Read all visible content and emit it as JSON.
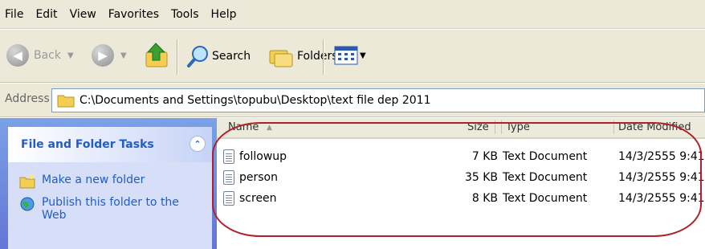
{
  "menu": [
    "File",
    "Edit",
    "View",
    "Favorites",
    "Tools",
    "Help"
  ],
  "toolbar": {
    "back_label": "Back",
    "search_label": "Search",
    "folders_label": "Folders"
  },
  "address": {
    "label": "Address",
    "path": "C:\\Documents and Settings\\topubu\\Desktop\\text file dep 2011"
  },
  "tasks": {
    "title": "File and Folder Tasks",
    "items": [
      "Make a new folder",
      "Publish this folder to the Web"
    ]
  },
  "columns": {
    "name": "Name",
    "size": "Size",
    "type": "Type",
    "date": "Date Modified"
  },
  "files": [
    {
      "name": "followup",
      "size": "7 KB",
      "type": "Text Document",
      "date": "14/3/2555 9:41"
    },
    {
      "name": "person",
      "size": "35 KB",
      "type": "Text Document",
      "date": "14/3/2555 9:41"
    },
    {
      "name": "screen",
      "size": "8 KB",
      "type": "Text Document",
      "date": "14/3/2555 9:41"
    }
  ],
  "annotation_color": "#b0202a"
}
